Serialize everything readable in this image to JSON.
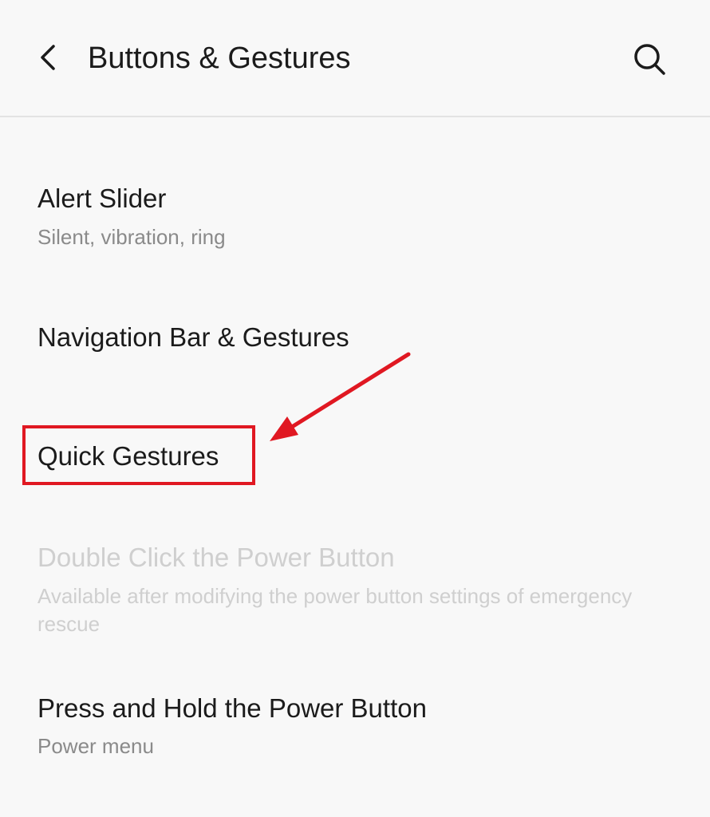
{
  "header": {
    "title": "Buttons & Gestures",
    "back_icon": "chevron-left-icon",
    "search_icon": "search-icon"
  },
  "settings": [
    {
      "title": "Alert Slider",
      "summary": "Silent, vibration, ring",
      "enabled": true
    },
    {
      "title": "Navigation Bar & Gestures",
      "summary": "",
      "enabled": true
    },
    {
      "title": "Quick Gestures",
      "summary": "",
      "enabled": true,
      "highlighted": true
    },
    {
      "title": "Double Click the Power Button",
      "summary": "Available after modifying the power button settings of emergency rescue",
      "enabled": false
    },
    {
      "title": "Press and Hold the Power Button",
      "summary": "Power menu",
      "enabled": true
    }
  ],
  "annotation": {
    "color": "#e01822",
    "target": "Quick Gestures"
  }
}
